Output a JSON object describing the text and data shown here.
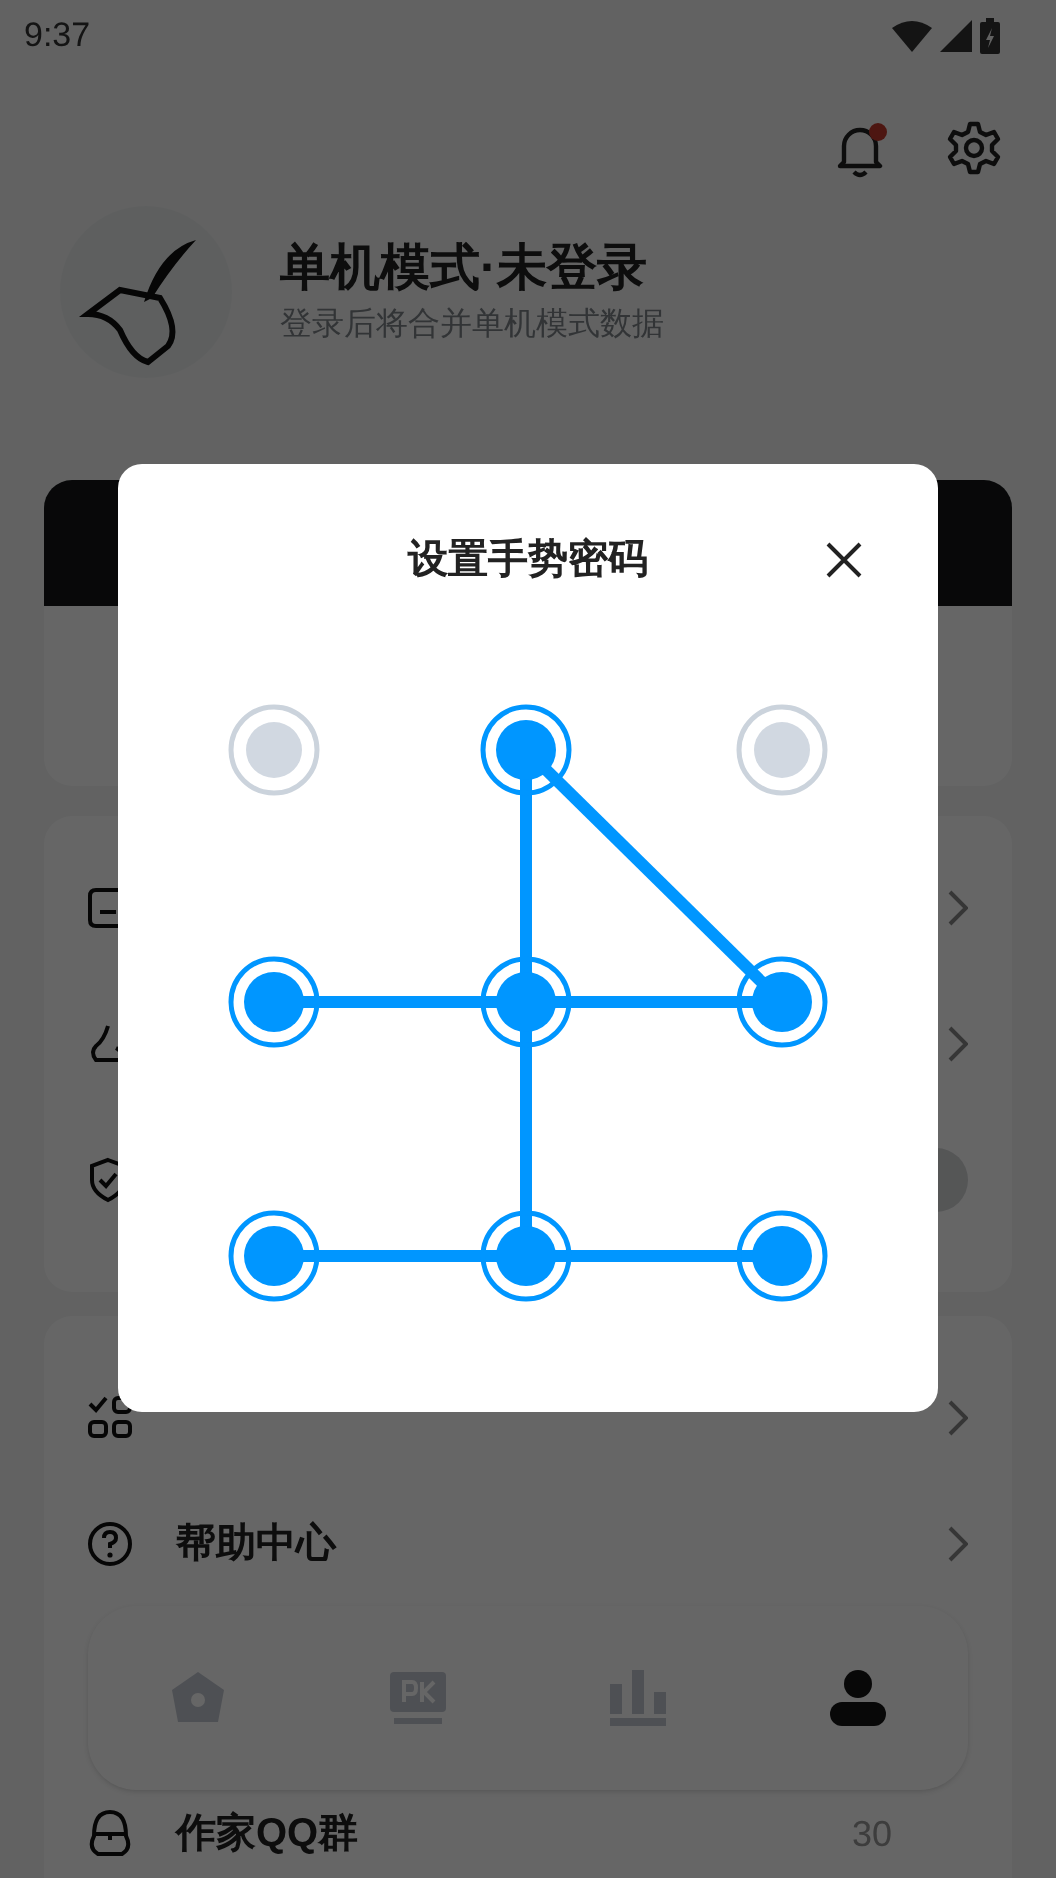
{
  "status_bar": {
    "time": "9:37"
  },
  "header": {
    "notification_badge": true
  },
  "profile": {
    "title": "单机模式·未登录",
    "subtitle": "登录后将合并单机模式数据"
  },
  "settings_rows": [
    {
      "kind": "chevron"
    },
    {
      "kind": "chevron"
    },
    {
      "kind": "toggle",
      "on": false
    }
  ],
  "menu_rows": [
    {
      "kind": "apps"
    },
    {
      "kind": "help",
      "label": "帮助中心"
    }
  ],
  "bottom_nav": [
    {
      "kind": "home",
      "selected": false
    },
    {
      "kind": "pk",
      "selected": false
    },
    {
      "kind": "chart",
      "selected": false
    },
    {
      "kind": "profile",
      "selected": true
    }
  ],
  "qq_row": {
    "label": "作家QQ群",
    "value": "30"
  },
  "dialog": {
    "title": "设置手势密码",
    "dots": [
      {
        "selected": false,
        "line_right": false,
        "line_down": false,
        "line_down_right": false
      },
      {
        "selected": true,
        "line_right": false,
        "line_down": true,
        "line_down_right": true
      },
      {
        "selected": false,
        "line_right": false,
        "line_down": false,
        "line_down_right": false
      },
      {
        "selected": true,
        "line_right": true,
        "line_down": false,
        "line_down_right": false
      },
      {
        "selected": true,
        "line_right": true,
        "line_down": true,
        "line_down_right": false
      },
      {
        "selected": true,
        "line_right": false,
        "line_down": false,
        "line_down_right": false
      },
      {
        "selected": true,
        "line_right": true,
        "line_down": false,
        "line_down_right": false
      },
      {
        "selected": true,
        "line_right": true,
        "line_down": false,
        "line_down_right": false
      },
      {
        "selected": true,
        "line_right": false,
        "line_down": false,
        "line_down_right": false
      }
    ]
  }
}
